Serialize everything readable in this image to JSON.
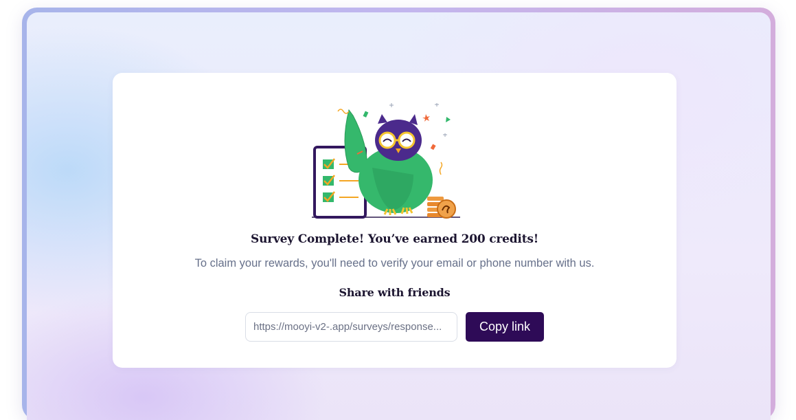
{
  "modal": {
    "illustration": "owl-survey-complete-illustration",
    "title": "Survey Complete! You’ve earned 200 credits!",
    "subtitle": "To claim your rewards, you'll need to verify your email or phone number with us.",
    "share_heading": "Share with friends",
    "share_link_value": "https://mooyi-v2-.app/surveys/response...",
    "copy_button_label": "Copy link"
  },
  "colors": {
    "primary": "#2e0b57",
    "owl_body": "#35b86c",
    "owl_head": "#4b2a8c",
    "accent_orange": "#e8892e",
    "text_dark": "#1c1530",
    "text_muted": "#66708a"
  }
}
